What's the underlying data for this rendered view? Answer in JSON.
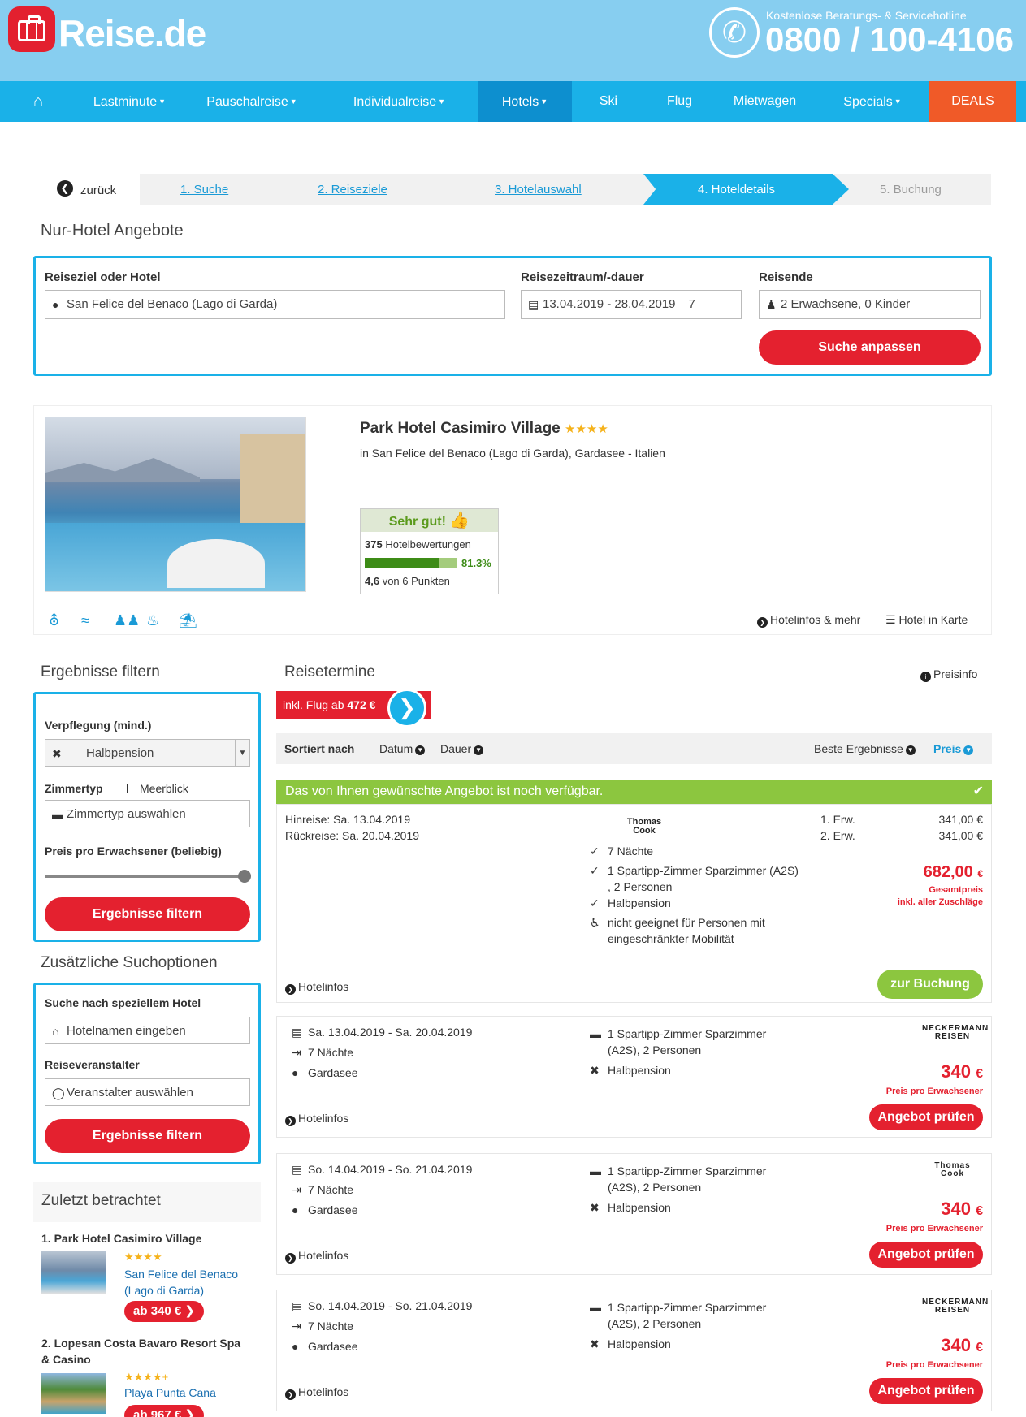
{
  "header": {
    "logo": "Reise.de",
    "hotline_label": "Kostenlose Beratungs- & Servicehotline",
    "hotline_number": "0800 / 100-4106"
  },
  "nav": {
    "items": [
      "Lastminute",
      "Pauschalreise",
      "Individualreise",
      "Hotels",
      "Ski",
      "Flug",
      "Mietwagen",
      "Specials",
      "DEALS"
    ],
    "active": "Hotels"
  },
  "breadcrumb": {
    "back": "zurück",
    "steps": [
      "1. Suche",
      "2. Reiseziele",
      "3. Hotelauswahl",
      "4. Hoteldetails",
      "5. Buchung"
    ]
  },
  "search": {
    "title": "Nur-Hotel Angebote",
    "dest_label": "Reiseziel oder Hotel",
    "dest_value": "San Felice del Benaco (Lago di Garda)",
    "date_label": "Reisezeitraum/-dauer",
    "date_value": "13.04.2019 - 28.04.2019",
    "duration": "7",
    "travel_label": "Reisende",
    "travel_value": "2 Erwachsene, 0 Kinder",
    "button": "Suche anpassen"
  },
  "hotel": {
    "name": "Park Hotel Casimiro Village",
    "stars": "★★★★",
    "location": "in San Felice del Benaco (Lago di Garda), Gardasee - Italien",
    "rating_word": "Sehr gut!",
    "reviews_count": "375",
    "reviews_label": "Hotelbewertungen",
    "recommend_pct": "81.3%",
    "recommend_fraction": 0.813,
    "score": "4,6",
    "score_label": "von 6 Punkten",
    "links": {
      "info": "Hotelinfos & mehr",
      "map": "Hotel in Karte"
    }
  },
  "filter": {
    "title": "Ergebnisse filtern",
    "board_label": "Verpflegung (mind.)",
    "board_value": "Halbpension",
    "room_label": "Zimmertyp",
    "seaview_label": "Meerblick",
    "room_placeholder": "Zimmertyp auswählen",
    "price_label": "Preis pro Erwachsener (beliebig)",
    "button": "Ergebnisse filtern"
  },
  "additional": {
    "title": "Zusätzliche Suchoptionen",
    "hotel_label": "Suche nach speziellem Hotel",
    "hotel_placeholder": "Hotelnamen eingeben",
    "operator_label": "Reiseveranstalter",
    "operator_placeholder": "Veranstalter auswählen",
    "button": "Ergebnisse filtern"
  },
  "recent": {
    "title": "Zuletzt betrachtet",
    "items": [
      {
        "name": "1. Park Hotel Casimiro Village",
        "stars": "★★★★",
        "loc1": "San Felice del Benaco",
        "loc2": "(Lago di Garda)",
        "price": "ab 340 € ❯"
      },
      {
        "name1": "2. Lopesan Costa Bavaro Resort Spa",
        "name2": "& Casino",
        "stars": "★★★★+",
        "loc1": "Playa Punta Cana",
        "price": "ab 967 € ❯"
      }
    ]
  },
  "results": {
    "title": "Reisetermine",
    "priceinfo": "Preisinfo",
    "badge_prefix": "inkl. Flug ab ",
    "badge_price": "472 €",
    "sort_label": "Sortiert nach",
    "sort_date": "Datum",
    "sort_duration": "Dauer",
    "sort_best": "Beste Ergebnisse",
    "sort_price": "Preis",
    "available": "Das von Ihnen gewünschte Angebot ist noch verfügbar.",
    "main": {
      "outbound": "Hinreise: Sa. 13.04.2019",
      "return": "Rückreise: Sa. 20.04.2019",
      "operator": "Thomas Cook",
      "nights": "7 Nächte",
      "room1": "1 Spartipp-Zimmer Sparzimmer (A2S)",
      "room2": ", 2 Personen",
      "board": "Halbpension",
      "access1": "nicht geeignet für Personen mit",
      "access2": "eingeschränkter Mobilität",
      "p1_label": "1. Erw.",
      "p1": "341,00 €",
      "p2_label": "2. Erw.",
      "p2": "341,00 €",
      "total": "682,00",
      "currency": "€",
      "total_label": "Gesamtpreis",
      "total_sub": "inkl. aller Zuschläge",
      "info": "Hotelinfos",
      "button": "zur Buchung"
    },
    "offers": [
      {
        "dates": "Sa. 13.04.2019 - Sa. 20.04.2019",
        "nights": "7 Nächte",
        "region": "Gardasee",
        "room1": "1 Spartipp-Zimmer Sparzimmer",
        "room2": "(A2S), 2 Personen",
        "board": "Halbpension",
        "operator": "NECKERMANN REISEN",
        "price": "340",
        "currency": "€",
        "price_label": "Preis pro Erwachsener",
        "info": "Hotelinfos",
        "button": "Angebot prüfen"
      },
      {
        "dates": "So. 14.04.2019 - So. 21.04.2019",
        "nights": "7 Nächte",
        "region": "Gardasee",
        "room1": "1 Spartipp-Zimmer Sparzimmer",
        "room2": "(A2S), 2 Personen",
        "board": "Halbpension",
        "operator": "Thomas Cook",
        "price": "340",
        "currency": "€",
        "price_label": "Preis pro Erwachsener",
        "info": "Hotelinfos",
        "button": "Angebot prüfen"
      },
      {
        "dates": "So. 14.04.2019 - So. 21.04.2019",
        "nights": "7 Nächte",
        "region": "Gardasee",
        "room1": "1 Spartipp-Zimmer Sparzimmer",
        "room2": "(A2S), 2 Personen",
        "board": "Halbpension",
        "operator": "NECKERMANN REISEN",
        "price": "340",
        "currency": "€",
        "price_label": "Preis pro Erwachsener",
        "info": "Hotelinfos",
        "button": "Angebot prüfen"
      }
    ]
  },
  "colors": {
    "brand_blue": "#1ab1e8",
    "header_bg": "#87cef0",
    "red": "#e4212f",
    "green": "#8cc63f",
    "deals": "#f05a28"
  }
}
